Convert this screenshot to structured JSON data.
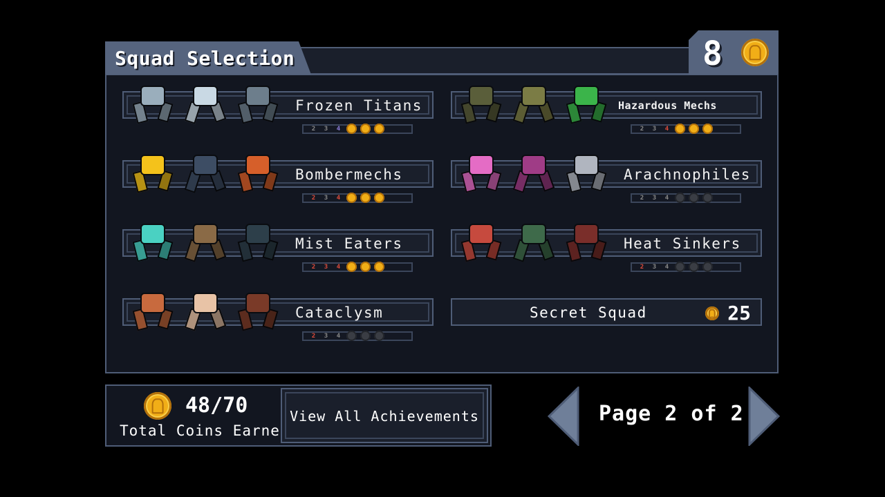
{
  "header": {
    "title": "Squad Selection",
    "coins": "8"
  },
  "squads": [
    {
      "name": "Frozen Titans",
      "trophies": [
        "2",
        "3",
        "4"
      ],
      "trophy_colors": [
        "#888",
        "#888",
        "#8c7dd8"
      ],
      "coins": [
        true,
        true,
        true
      ],
      "mech_colors": [
        "#9aaebc",
        "#c9d9e4",
        "#6d7e8c"
      ]
    },
    {
      "name": "Hazardous Mechs",
      "trophies": [
        "2",
        "3",
        "4"
      ],
      "trophy_colors": [
        "#888",
        "#888",
        "#d94b3b"
      ],
      "coins": [
        true,
        true,
        true
      ],
      "mech_colors": [
        "#5a5e3a",
        "#7b7c45",
        "#3bb44a"
      ]
    },
    {
      "name": "Bombermechs",
      "trophies": [
        "2",
        "3",
        "4"
      ],
      "trophy_colors": [
        "#d94b3b",
        "#888",
        "#d94b3b"
      ],
      "coins": [
        true,
        true,
        true
      ],
      "mech_colors": [
        "#f4c21b",
        "#3d4d64",
        "#d65f2a"
      ]
    },
    {
      "name": "Arachnophiles",
      "trophies": [
        "2",
        "3",
        "4"
      ],
      "trophy_colors": [
        "#888",
        "#888",
        "#888"
      ],
      "coins": [
        false,
        false,
        false
      ],
      "mech_colors": [
        "#e46cc5",
        "#9f3c86",
        "#b0b5bf"
      ]
    },
    {
      "name": "Mist Eaters",
      "trophies": [
        "2",
        "3",
        "4"
      ],
      "trophy_colors": [
        "#d94b3b",
        "#d94b3b",
        "#d94b3b"
      ],
      "coins": [
        true,
        true,
        true
      ],
      "mech_colors": [
        "#4ad1c2",
        "#8a6a46",
        "#2d3f4a"
      ]
    },
    {
      "name": "Heat Sinkers",
      "trophies": [
        "2",
        "3",
        "4"
      ],
      "trophy_colors": [
        "#d94b3b",
        "#888",
        "#888"
      ],
      "coins": [
        false,
        false,
        false
      ],
      "mech_colors": [
        "#c64a3e",
        "#3e6a4a",
        "#7a2e2a"
      ]
    },
    {
      "name": "Cataclysm",
      "trophies": [
        "2",
        "3",
        "4"
      ],
      "trophy_colors": [
        "#d94b3b",
        "#888",
        "#888"
      ],
      "coins": [
        false,
        false,
        false
      ],
      "mech_colors": [
        "#c86a3e",
        "#e8c3a6",
        "#7a3a28"
      ]
    }
  ],
  "secret": {
    "label": "Secret Squad",
    "price": "25"
  },
  "coins_summary": {
    "total": "48/70",
    "label": "Total Coins Earned"
  },
  "achievements_button": "View All Achievements",
  "pagination": {
    "label": "Page 2 of 2"
  }
}
